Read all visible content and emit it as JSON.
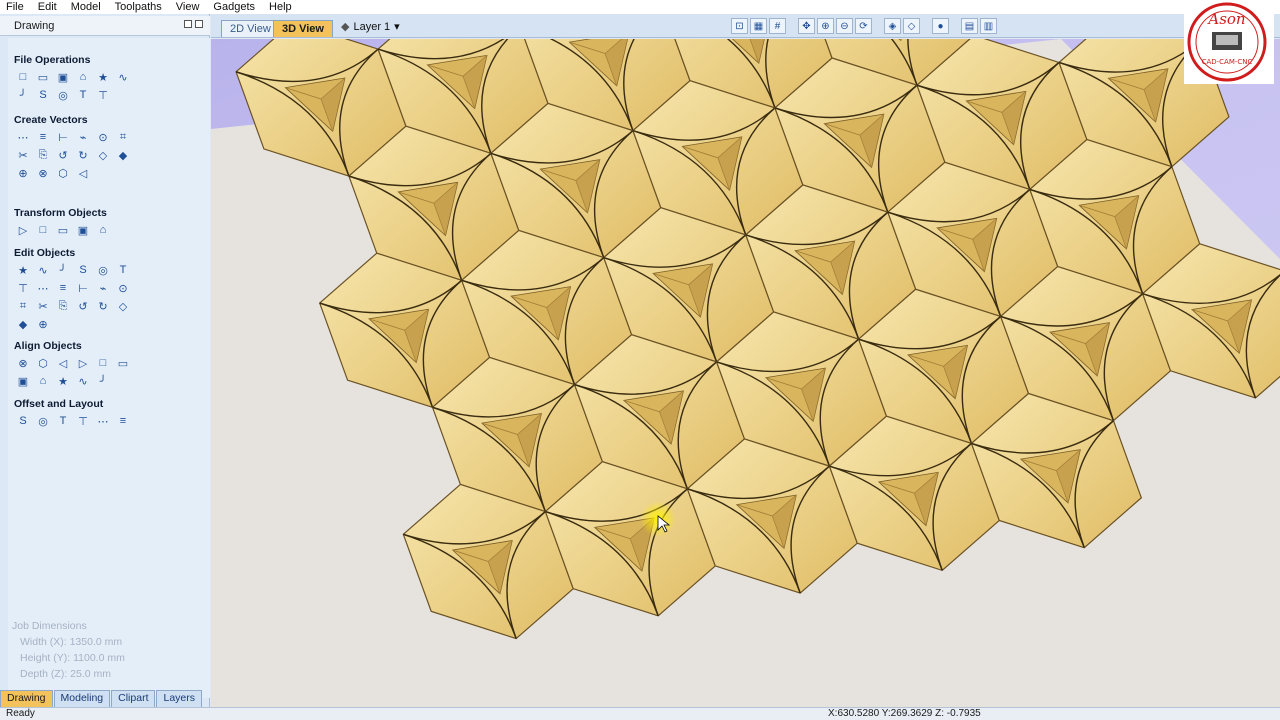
{
  "menu": [
    "File",
    "Edit",
    "Model",
    "Toolpaths",
    "View",
    "Gadgets",
    "Help"
  ],
  "panel": {
    "title": "Drawing",
    "sections": [
      {
        "name": "File Operations",
        "icons": [
          "new-file-icon",
          "open-file-icon",
          "save-icon",
          "import-icon",
          "folder-icon",
          "select-all-icon",
          "cut-icon",
          "copy-icon",
          "paste-icon",
          "undo-icon",
          "redo-icon"
        ]
      },
      {
        "name": "Create Vectors",
        "icons": [
          "circle-icon",
          "ellipse-icon",
          "rectangle-icon",
          "polygon-icon",
          "star-icon",
          "polyline-icon",
          "arc-icon",
          "curve-icon",
          "spiral-icon",
          "text-icon",
          "text-box-icon",
          "text-on-curve-icon",
          "adjust-text-icon",
          "dimension-icon",
          "trace-icon",
          "offset-icon"
        ]
      },
      {
        "name": "Transform Objects",
        "icons": [
          "move-icon",
          "scale-icon",
          "rotate-icon",
          "mirror-icon",
          "center-icon"
        ]
      },
      {
        "name": "Edit Objects",
        "icons": [
          "node-edit-icon",
          "node-add-icon",
          "join-icon",
          "weld-icon",
          "smooth-icon",
          "trim-icon",
          "fillet-icon",
          "chamfer-icon",
          "cut-scissors-icon",
          "extend-icon",
          "curve-fit-icon",
          "convert-icon",
          "arc-fit-icon",
          "close-icon",
          "fit-icon",
          "boolean-icon",
          "split-icon",
          "join-nodes-icon",
          "snap-icon",
          "corner-icon"
        ]
      },
      {
        "name": "Align Objects",
        "icons": [
          "align-center-icon",
          "align-h-icon",
          "align-v-icon",
          "align-left-icon",
          "align-top-icon",
          "align-bottom-icon",
          "distribute-h-icon",
          "distribute-v-icon",
          "align-mid-icon",
          "spacing-icon",
          "spacing-v-icon"
        ]
      },
      {
        "name": "Offset and Layout",
        "icons": [
          "offset-layout-icon",
          "array-icon",
          "nest-icon",
          "step-repeat-icon",
          "grid-layout-icon",
          "wrap-icon"
        ]
      }
    ],
    "job_dimensions": {
      "title": "Job Dimensions",
      "width": "Width  (X): 1350.0 mm",
      "height": "Height (Y): 1100.0 mm",
      "depth": "Depth  (Z): 25.0 mm"
    },
    "bottom_tabs": [
      "Drawing",
      "Modeling",
      "Clipart",
      "Layers"
    ]
  },
  "view": {
    "tab_2d": "2D View",
    "tab_3d": "3D View",
    "layer_label": "Layer 1",
    "layer_arrow": "▾"
  },
  "status": {
    "ready": "Ready",
    "coords": "X:630.5280 Y:269.3629 Z: -0.7935"
  },
  "colors": {
    "tile_light": "#f2dc9a",
    "tile_mid": "#e2c06a",
    "tile_dark": "#b68d3c",
    "plane": "#e6e3df",
    "background": "#c3bdef",
    "highlight": "#fff200"
  },
  "logo": {
    "brand": "Ason",
    "tagline": "CAD-CAM-CNC"
  }
}
